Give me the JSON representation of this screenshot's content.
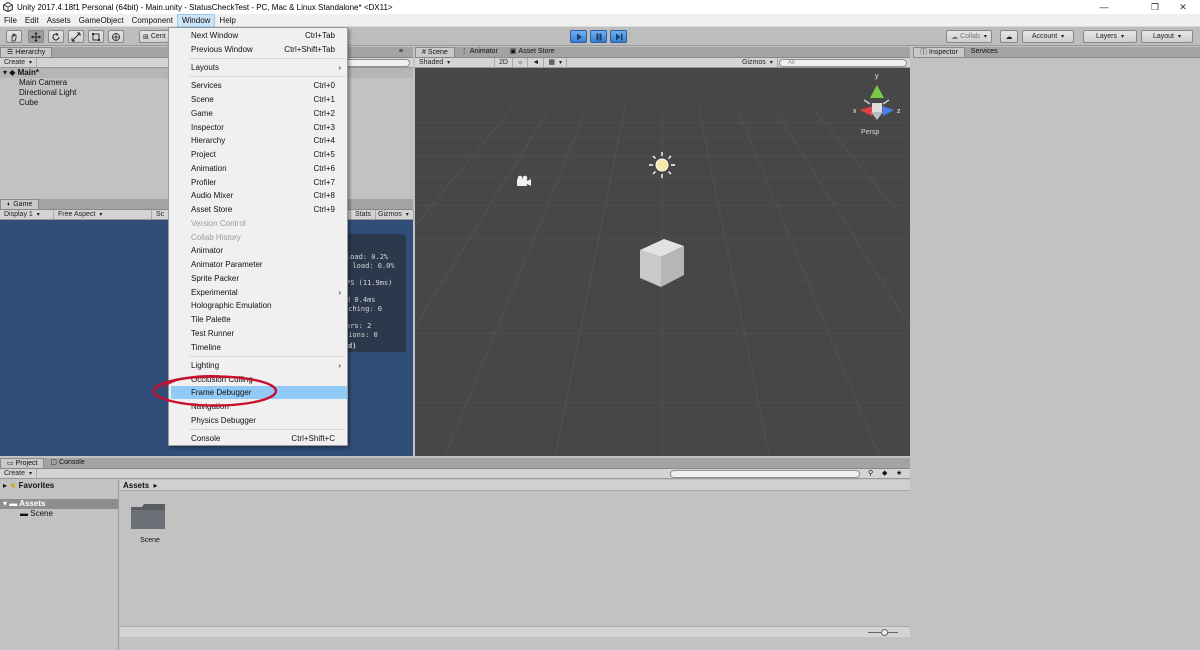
{
  "window": {
    "title": "Unity 2017.4.18f1 Personal (64bit) - Main.unity - StatusCheckTest - PC, Mac & Linux Standalone* <DX11>",
    "controls": [
      "—",
      "❐",
      "✕"
    ]
  },
  "menubar": [
    "File",
    "Edit",
    "Assets",
    "GameObject",
    "Component",
    "Window",
    "Help"
  ],
  "toolbar": {
    "pivot_label": "Cent",
    "collab_label": "Collab",
    "account_label": "Account",
    "layers_label": "Layers",
    "layout_label": "Layout"
  },
  "hierarchy": {
    "tab": "Hierarchy",
    "create_label": "Create",
    "scene_name": "Main*",
    "items": [
      "Main Camera",
      "Directional Light",
      "Cube"
    ]
  },
  "game": {
    "tab": "Game",
    "display_label": "Display 1",
    "aspect_label": "Free Aspect",
    "scale_label": "Sc",
    "stats_label": "Stats",
    "gizmos_label": "Gizmos",
    "stats_lines": [
      "load: 0.2%",
      "n load: 0.0%",
      "PS (11.9ms)",
      "d 0.4ms",
      "tching: 0",
      "ers: 2",
      "tions: 0",
      "d)"
    ]
  },
  "scene": {
    "tabs": [
      "Scene",
      "Animator",
      "Asset Store"
    ],
    "shading_label": "Shaded",
    "mode_2d_label": "2D",
    "gizmos_label": "Gizmos",
    "search_placeholder": "All",
    "persp_label": "Persp",
    "axis_labels": [
      "y",
      "x",
      "z"
    ]
  },
  "inspector": {
    "tabs": [
      "Inspector",
      "Services"
    ]
  },
  "project": {
    "tabs": [
      "Project",
      "Console"
    ],
    "create_label": "Create",
    "favorites_label": "Favorites",
    "assets_label": "Assets",
    "tree_items": [
      "Scene"
    ],
    "breadcrumb": "Assets",
    "breadcrumb_sep": "▸",
    "folder_name": "Scene"
  },
  "window_menu": {
    "items": [
      {
        "label": "Next Window",
        "shortcut": "Ctrl+Tab"
      },
      {
        "label": "Previous Window",
        "shortcut": "Ctrl+Shift+Tab"
      },
      {
        "label": "Layouts",
        "submenu": "›"
      },
      {
        "label": "Services",
        "shortcut": "Ctrl+0"
      },
      {
        "label": "Scene",
        "shortcut": "Ctrl+1"
      },
      {
        "label": "Game",
        "shortcut": "Ctrl+2"
      },
      {
        "label": "Inspector",
        "shortcut": "Ctrl+3"
      },
      {
        "label": "Hierarchy",
        "shortcut": "Ctrl+4"
      },
      {
        "label": "Project",
        "shortcut": "Ctrl+5"
      },
      {
        "label": "Animation",
        "shortcut": "Ctrl+6"
      },
      {
        "label": "Profiler",
        "shortcut": "Ctrl+7"
      },
      {
        "label": "Audio Mixer",
        "shortcut": "Ctrl+8"
      },
      {
        "label": "Asset Store",
        "shortcut": "Ctrl+9"
      },
      {
        "label": "Version Control",
        "disabled": true
      },
      {
        "label": "Collab History",
        "disabled": true
      },
      {
        "label": "Animator"
      },
      {
        "label": "Animator Parameter"
      },
      {
        "label": "Sprite Packer"
      },
      {
        "label": "Experimental",
        "submenu": "›"
      },
      {
        "label": "Holographic Emulation"
      },
      {
        "label": "Tile Palette"
      },
      {
        "label": "Test Runner"
      },
      {
        "label": "Timeline"
      },
      {
        "label": "Lighting",
        "submenu": "›"
      },
      {
        "label": "Occlusion Culling"
      },
      {
        "label": "Frame Debugger",
        "highlighted": true
      },
      {
        "label": "Navigation"
      },
      {
        "label": "Physics Debugger"
      },
      {
        "label": "Console",
        "shortcut": "Ctrl+Shift+C"
      }
    ]
  },
  "colors": {
    "menu_highlight": "#91c9f7",
    "annotation_circle": "#c8102e",
    "game_bg": "#314d79",
    "scene_bg": "#474747",
    "play_button": "#3b7fd0"
  }
}
